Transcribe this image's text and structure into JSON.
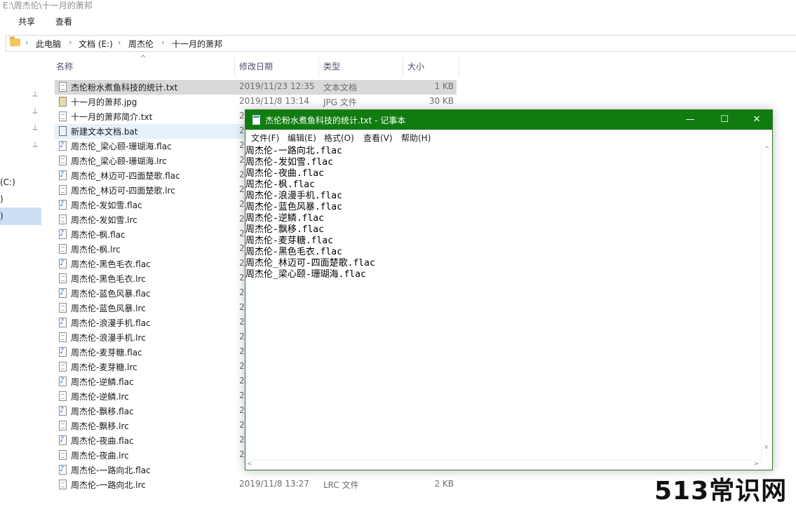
{
  "explorer": {
    "title": "E:\\周杰伦\\十一月的萧邦",
    "ribbon_tabs": [
      "共享",
      "查看"
    ],
    "breadcrumb": [
      "此电脑",
      "文档 (E:)",
      "周杰伦",
      "十一月的萧邦"
    ],
    "nav_items": [
      "(C:)",
      ")",
      ")"
    ],
    "columns": {
      "name": "名称",
      "date": "修改日期",
      "type": "类型",
      "size": "大小"
    },
    "files": [
      {
        "name": "杰伦粉水煮鱼科技的统计.txt",
        "date": "2019/11/23 12:35",
        "type": "文本文档",
        "size": "1 KB",
        "icon": "text-file-icon",
        "state": "selected"
      },
      {
        "name": "十一月的萧邦.jpg",
        "date": "2019/11/8 13:14",
        "type": "JPG 文件",
        "size": "30 KB",
        "icon": "image-file-icon"
      },
      {
        "name": "十一月的萧邦简介.txt",
        "date": "2",
        "type": "",
        "size": "",
        "icon": "text-file-icon"
      },
      {
        "name": "新建文本文档.bat",
        "date": "2",
        "type": "",
        "size": "",
        "icon": "batch-file-icon",
        "state": "hover"
      },
      {
        "name": "周杰伦_梁心颐-珊瑚海.flac",
        "date": "2",
        "type": "",
        "size": "",
        "icon": "audio-file-icon"
      },
      {
        "name": "周杰伦_梁心颐-珊瑚海.lrc",
        "date": "2",
        "type": "",
        "size": "",
        "icon": "text-file-icon"
      },
      {
        "name": "周杰伦_林迈可-四面楚歌.flac",
        "date": "2",
        "type": "",
        "size": "",
        "icon": "audio-file-icon"
      },
      {
        "name": "周杰伦_林迈可-四面楚歌.lrc",
        "date": "2",
        "type": "",
        "size": "",
        "icon": "text-file-icon"
      },
      {
        "name": "周杰伦-发如雪.flac",
        "date": "2",
        "type": "",
        "size": "",
        "icon": "audio-file-icon"
      },
      {
        "name": "周杰伦-发如雪.lrc",
        "date": "2",
        "type": "",
        "size": "",
        "icon": "text-file-icon"
      },
      {
        "name": "周杰伦-枫.flac",
        "date": "2",
        "type": "",
        "size": "",
        "icon": "audio-file-icon"
      },
      {
        "name": "周杰伦-枫.lrc",
        "date": "2",
        "type": "",
        "size": "",
        "icon": "text-file-icon"
      },
      {
        "name": "周杰伦-黑色毛衣.flac",
        "date": "2",
        "type": "",
        "size": "",
        "icon": "audio-file-icon"
      },
      {
        "name": "周杰伦-黑色毛衣.lrc",
        "date": "2",
        "type": "",
        "size": "",
        "icon": "text-file-icon"
      },
      {
        "name": "周杰伦-蓝色风暴.flac",
        "date": "2",
        "type": "",
        "size": "",
        "icon": "audio-file-icon"
      },
      {
        "name": "周杰伦-蓝色风暴.lrc",
        "date": "2",
        "type": "",
        "size": "",
        "icon": "text-file-icon"
      },
      {
        "name": "周杰伦-浪漫手机.flac",
        "date": "2",
        "type": "",
        "size": "",
        "icon": "audio-file-icon"
      },
      {
        "name": "周杰伦-浪漫手机.lrc",
        "date": "2",
        "type": "",
        "size": "",
        "icon": "text-file-icon"
      },
      {
        "name": "周杰伦-麦芽糖.flac",
        "date": "2",
        "type": "",
        "size": "",
        "icon": "audio-file-icon"
      },
      {
        "name": "周杰伦-麦芽糖.lrc",
        "date": "2",
        "type": "",
        "size": "",
        "icon": "text-file-icon"
      },
      {
        "name": "周杰伦-逆鳞.flac",
        "date": "2",
        "type": "",
        "size": "",
        "icon": "audio-file-icon"
      },
      {
        "name": "周杰伦-逆鳞.lrc",
        "date": "2",
        "type": "",
        "size": "",
        "icon": "text-file-icon"
      },
      {
        "name": "周杰伦-飘移.flac",
        "date": "2",
        "type": "",
        "size": "",
        "icon": "audio-file-icon"
      },
      {
        "name": "周杰伦-飘移.lrc",
        "date": "2",
        "type": "",
        "size": "",
        "icon": "text-file-icon"
      },
      {
        "name": "周杰伦-夜曲.flac",
        "date": "2",
        "type": "",
        "size": "",
        "icon": "audio-file-icon"
      },
      {
        "name": "周杰伦-夜曲.lrc",
        "date": "2",
        "type": "",
        "size": "",
        "icon": "text-file-icon"
      },
      {
        "name": "周杰伦-一路向北.flac",
        "date": "",
        "type": "",
        "size": "",
        "icon": "audio-file-icon"
      },
      {
        "name": "周杰伦-一路向北.lrc",
        "date": "2019/11/8 13:27",
        "type": "LRC 文件",
        "size": "2 KB",
        "icon": "text-file-icon"
      }
    ]
  },
  "notepad": {
    "title": "杰伦粉水煮鱼科技的统计.txt - 记事本",
    "menu": [
      "文件(F)",
      "编辑(E)",
      "格式(O)",
      "查看(V)",
      "帮助(H)"
    ],
    "lines": [
      "周杰伦-一路向北.flac",
      "周杰伦-发如雪.flac",
      "周杰伦-夜曲.flac",
      "周杰伦-枫.flac",
      "周杰伦-浪漫手机.flac",
      "周杰伦-蓝色风暴.flac",
      "周杰伦-逆鳞.flac",
      "周杰伦-飘移.flac",
      "周杰伦-麦芽糖.flac",
      "周杰伦-黑色毛衣.flac",
      "周杰伦_林迈可-四面楚歌.flac",
      "周杰伦_梁心颐-珊瑚海.flac"
    ],
    "accent_color": "#107c10"
  },
  "watermark": "513常识网"
}
